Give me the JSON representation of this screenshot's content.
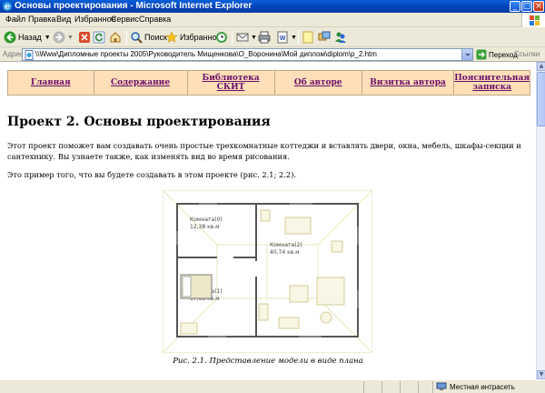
{
  "window": {
    "title": "Основы проектирования - Microsoft Internet Explorer"
  },
  "menu": [
    "Файл",
    "Правка",
    "Вид",
    "Избранное",
    "Сервис",
    "Справка"
  ],
  "toolbar": {
    "back_label": "Назад",
    "search_label": "Поиск",
    "favorites_label": "Избранное"
  },
  "address": {
    "label": "Адрес:",
    "url": "\\\\Www\\Дипломные проекты 2005\\Руководитель Мищенкова\\О_Воронина\\Мой диплом\\diplom\\p_2.htm",
    "go_label": "Переход",
    "links_label": "Ссылки"
  },
  "page": {
    "nav": [
      "Главная",
      "Содержание",
      "Библиотека СКИТ",
      "Об авторе",
      "Визитка автора",
      "Пояснительная записка"
    ],
    "heading": "Проект 2. Основы проектирования",
    "paragraph1": "Этот проект поможет вам создавать очень простые трехкомнатные коттеджи и вставлять двери, окна, мебель, шкафы-секции и сантехнику. Вы узнаете также, как изменять вид во время рисования.",
    "paragraph2": "Это пример того, что вы будете создавать в этом проекте (рис. 2.1; 2.2).",
    "figure": {
      "room0": [
        "Комната(0)",
        "12,38 кв.м"
      ],
      "room1": [
        "Комната(1)",
        "17,68 кв.м"
      ],
      "room2": [
        "Комната(2)",
        "40,74 кв.м"
      ]
    },
    "caption": "Рис. 2.1. Представление модели в виде плана"
  },
  "status": {
    "zone_label": "Местная интрасеть"
  }
}
